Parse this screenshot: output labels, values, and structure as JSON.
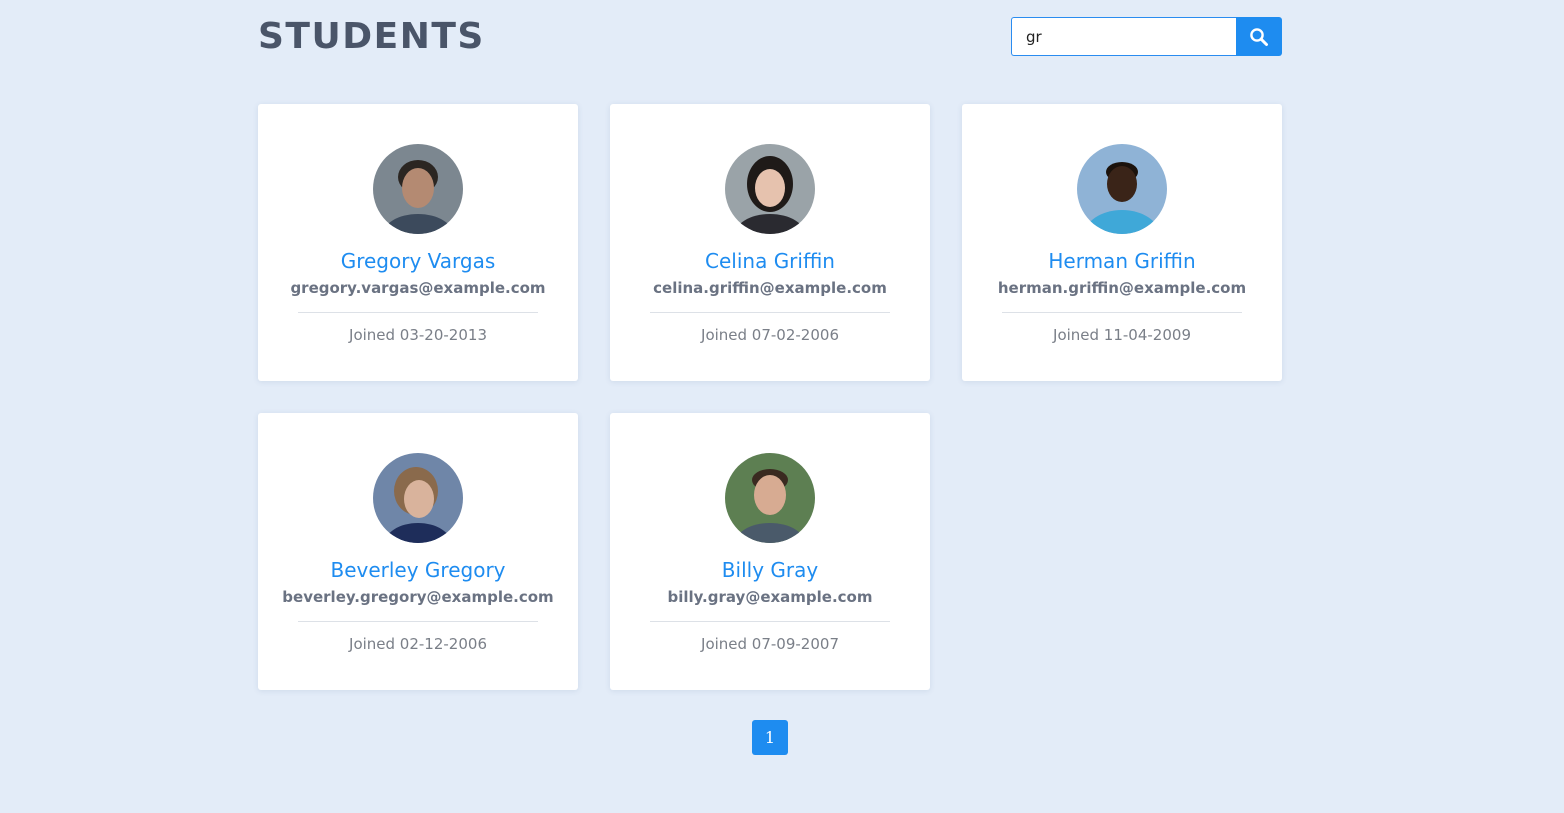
{
  "header": {
    "title": "STUDENTS",
    "search_value": "gr",
    "search_icon": "search-icon"
  },
  "students": [
    {
      "name": "Gregory Vargas",
      "email": "gregory.vargas@example.com",
      "joined": "Joined 03-20-2013",
      "avatar": {
        "bg": "#7c8790",
        "face": "#b48a72",
        "hair": "#2b2622",
        "shirt": "#3c4a5c"
      }
    },
    {
      "name": "Celina Griffin",
      "email": "celina.griffin@example.com",
      "joined": "Joined 07-02-2006",
      "avatar": {
        "bg": "#9aa3a8",
        "face": "#e6c2ae",
        "hair": "#1f1a18",
        "shirt": "#2a2a30"
      }
    },
    {
      "name": "Herman Griffin",
      "email": "herman.griffin@example.com",
      "joined": "Joined 11-04-2009",
      "avatar": {
        "bg": "#8fb3d6",
        "face": "#3a2418",
        "hair": "#1b120c",
        "shirt": "#3fa8d8"
      }
    },
    {
      "name": "Beverley Gregory",
      "email": "beverley.gregory@example.com",
      "joined": "Joined 02-12-2006",
      "avatar": {
        "bg": "#6f86a8",
        "face": "#d9b39c",
        "hair": "#8a6a4c",
        "shirt": "#1e2d5a"
      }
    },
    {
      "name": "Billy Gray",
      "email": "billy.gray@example.com",
      "joined": "Joined 07-09-2007",
      "avatar": {
        "bg": "#5d7f52",
        "face": "#d7ab92",
        "hair": "#3a2a20",
        "shirt": "#4a5a6a"
      }
    }
  ],
  "pagination": {
    "current": "1"
  },
  "colors": {
    "accent": "#1e8cf0",
    "background": "#e3ecf8",
    "title": "#4a5569"
  }
}
